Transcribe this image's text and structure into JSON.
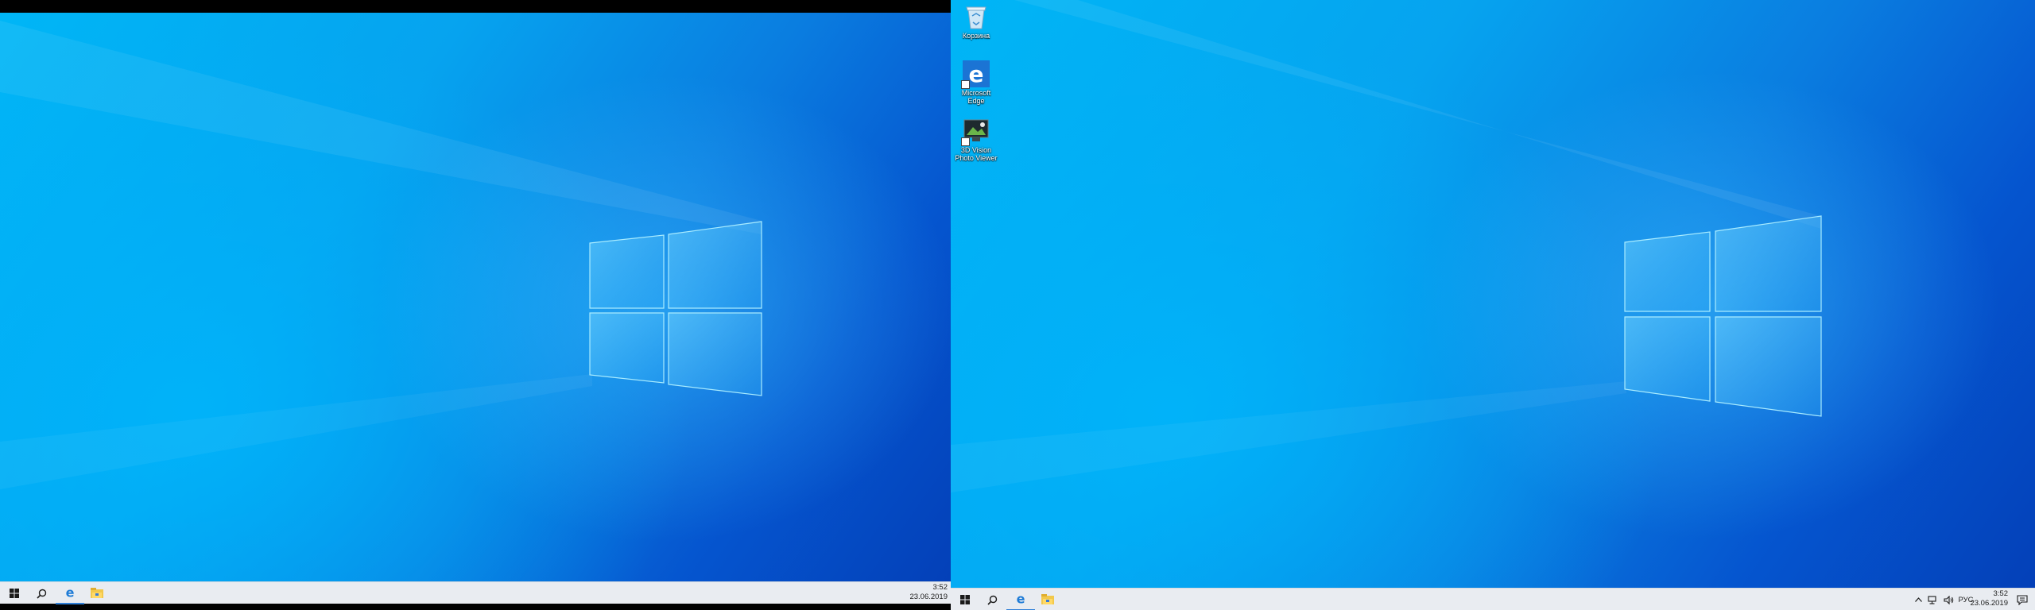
{
  "screens": {
    "left": {
      "taskbar": {
        "start_icon": "windows-start-icon",
        "search_icon": "search-icon",
        "apps": [
          {
            "name": "Microsoft Edge",
            "icon": "edge-icon",
            "active": true
          },
          {
            "name": "File Explorer",
            "icon": "folder-icon",
            "active": false
          }
        ],
        "clock": {
          "time": "3:52",
          "date": "23.06.2019"
        }
      }
    },
    "right": {
      "desktop_icons": [
        {
          "label": "Корзина",
          "icon": "recycle-bin-icon"
        },
        {
          "label": "Microsoft Edge",
          "icon": "edge-icon"
        },
        {
          "label": "3D Vision Photo Viewer",
          "icon": "photo-viewer-icon"
        }
      ],
      "taskbar": {
        "start_icon": "windows-start-icon",
        "search_icon": "search-icon",
        "apps": [
          {
            "name": "Microsoft Edge",
            "icon": "edge-icon",
            "active": true
          },
          {
            "name": "File Explorer",
            "icon": "folder-icon",
            "active": false
          }
        ],
        "tray": {
          "chevron_icon": "chevron-up-icon",
          "network_icon": "network-icon",
          "volume_icon": "volume-icon",
          "language": "РУС"
        },
        "clock": {
          "time": "3:52",
          "date": "23.06.2019"
        },
        "notification_icon": "notification-icon"
      }
    }
  },
  "colors": {
    "taskbar_bg": "#e9ecf1",
    "wallpaper_light": "#00b6f6",
    "wallpaper_dark": "#0440b8",
    "active_indicator": "#2f7fd8"
  }
}
